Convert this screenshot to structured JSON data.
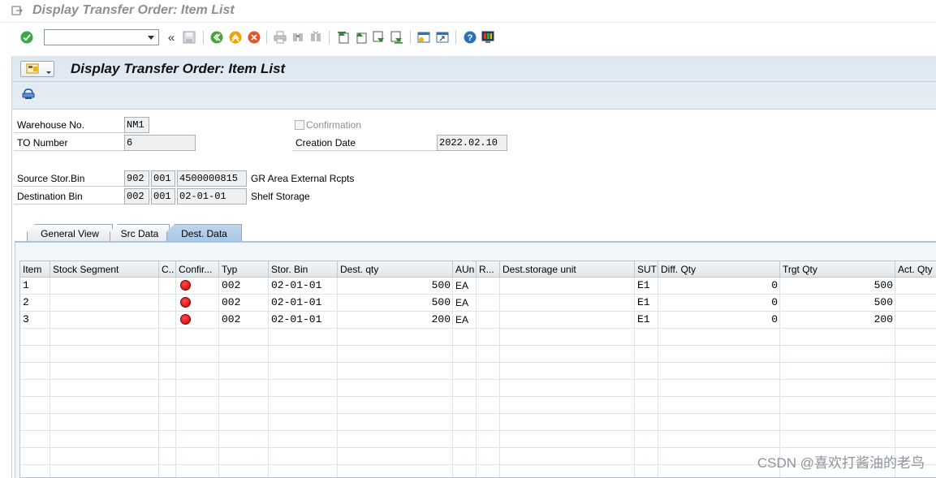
{
  "window": {
    "title": "Display Transfer Order: Item List"
  },
  "toolbar": {
    "command_value": "",
    "icons": [
      "enter-icon",
      "command-dropdown-icon",
      "collapse-icon",
      "save-icon",
      "back-icon",
      "exit-icon",
      "cancel-icon",
      "print-icon",
      "find-icon",
      "find-next-icon",
      "first-page-icon",
      "previous-page-icon",
      "next-page-icon",
      "last-page-icon",
      "create-session-icon",
      "shortcut-icon",
      "help-icon",
      "customize-layout-icon"
    ]
  },
  "header": {
    "title": "Display Transfer Order: Item List"
  },
  "form": {
    "warehouse_label": "Warehouse No.",
    "warehouse_value": "NM1",
    "to_label": "TO Number",
    "to_value": "6",
    "confirmation_label": "Confirmation",
    "creation_date_label": "Creation Date",
    "creation_date_value": "2022.02.10",
    "source_label": "Source Stor.Bin",
    "source_type": "902",
    "source_section": "001",
    "source_bin": "4500000815",
    "source_desc": "GR Area External Rcpts",
    "dest_label": "Destination Bin",
    "dest_type": "002",
    "dest_section": "001",
    "dest_bin": "02-01-01",
    "dest_desc": "Shelf Storage"
  },
  "tabs": [
    {
      "label": "General View",
      "active": false
    },
    {
      "label": "Src Data",
      "active": false
    },
    {
      "label": "Dest. Data",
      "active": true
    }
  ],
  "table": {
    "columns": [
      "Item",
      "Stock Segment",
      "C..",
      "Confir...",
      "Typ",
      "Stor. Bin",
      "Dest. qty",
      "AUn",
      "R...",
      "Dest.storage unit",
      "SUT",
      "Diff. Qty",
      "Trgt Qty",
      "Act. Qty"
    ],
    "rows": [
      {
        "item": "1",
        "segment": "",
        "c": "",
        "confirm_status": "red",
        "typ": "002",
        "bin": "02-01-01",
        "dest_qty": "500",
        "aun": "EA",
        "r": "",
        "su": "",
        "sut": "E1",
        "diff": "0",
        "trgt": "500",
        "act": ""
      },
      {
        "item": "2",
        "segment": "",
        "c": "",
        "confirm_status": "red",
        "typ": "002",
        "bin": "02-01-01",
        "dest_qty": "500",
        "aun": "EA",
        "r": "",
        "su": "",
        "sut": "E1",
        "diff": "0",
        "trgt": "500",
        "act": ""
      },
      {
        "item": "3",
        "segment": "",
        "c": "",
        "confirm_status": "red",
        "typ": "002",
        "bin": "02-01-01",
        "dest_qty": "200",
        "aun": "EA",
        "r": "",
        "su": "",
        "sut": "E1",
        "diff": "0",
        "trgt": "200",
        "act": ""
      }
    ]
  },
  "watermark": "CSDN @喜欢打酱油的老鸟",
  "colors": {
    "status_red": "#e00000",
    "tab_active": "#a8c6e3",
    "header_bg": "#dde8f1"
  }
}
